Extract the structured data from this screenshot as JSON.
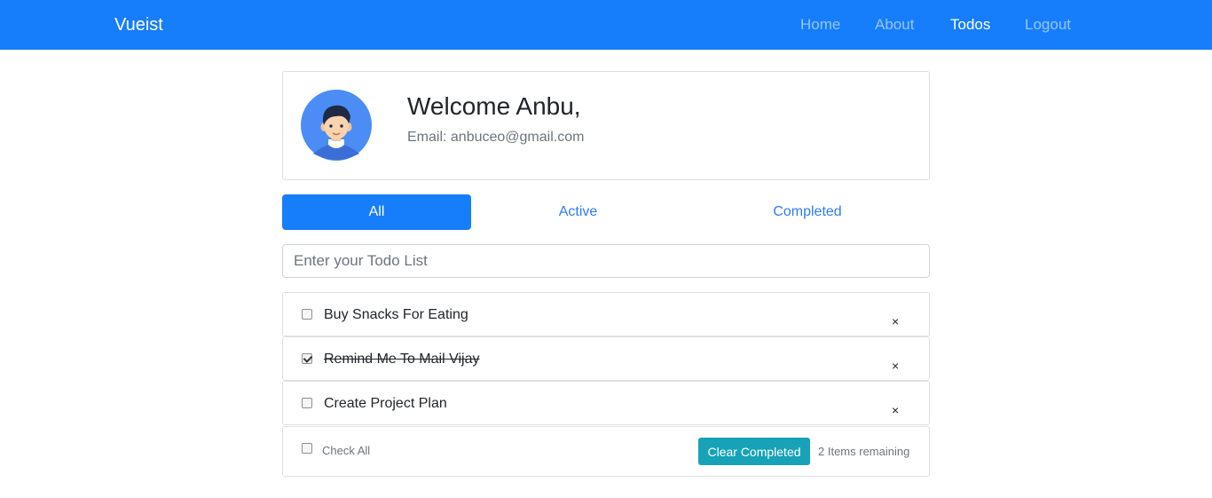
{
  "navbar": {
    "brand": "Vueist",
    "links": [
      {
        "label": "Home",
        "active": false
      },
      {
        "label": "About",
        "active": false
      },
      {
        "label": "Todos",
        "active": true
      },
      {
        "label": "Logout",
        "active": false
      }
    ],
    "color": "#167dfb"
  },
  "profile": {
    "avatar_icon": "user-avatar-icon",
    "welcome": "Welcome Anbu,",
    "email": "Email: anbuceo@gmail.com"
  },
  "filters": {
    "tabs": [
      {
        "label": "All",
        "active": true
      },
      {
        "label": "Active",
        "active": false
      },
      {
        "label": "Completed",
        "active": false
      }
    ]
  },
  "todo_input": {
    "placeholder": "Enter your Todo List",
    "value": ""
  },
  "todos": [
    {
      "text": "Buy Snacks For Eating",
      "completed": false,
      "remove_label": "×"
    },
    {
      "text": "Remind Me To Mail Vijay",
      "completed": true,
      "remove_label": "×"
    },
    {
      "text": "Create Project Plan",
      "completed": false,
      "remove_label": "×"
    }
  ],
  "footer": {
    "check_all_label": "Check All",
    "clear_button": "Clear Completed",
    "remaining": "2 Items remaining",
    "button_color": "#17a2b8"
  }
}
